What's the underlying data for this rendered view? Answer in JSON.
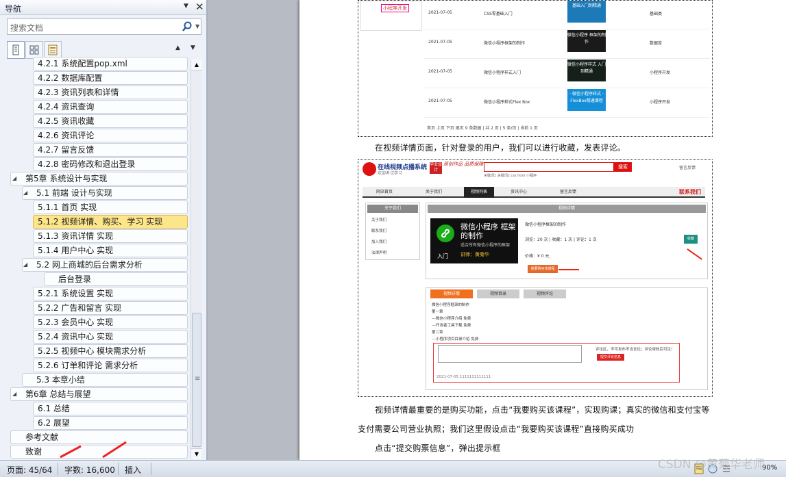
{
  "nav": {
    "title": "导航",
    "search_placeholder": "搜索文档",
    "items": [
      {
        "label": "4.2.1 系统配置pop.xml"
      },
      {
        "label": "4.2.2 数据库配置"
      },
      {
        "label": "4.2.3 资讯列表和详情"
      },
      {
        "label": "4.2.4 资讯查询"
      },
      {
        "label": "4.2.5 资讯收藏"
      },
      {
        "label": "4.2.6 资讯评论"
      },
      {
        "label": "4.2.7 留言反馈"
      },
      {
        "label": "4.2.8 密码修改和退出登录"
      },
      {
        "label": "第5章 系统设计与实现"
      },
      {
        "label": "5.1 前端 设计与实现"
      },
      {
        "label": "5.1.1 首页 实现"
      },
      {
        "label": "5.1.2 视频详情、购买、学习 实现"
      },
      {
        "label": "5.1.3 资讯详情 实现"
      },
      {
        "label": "5.1.4 用户中心 实现"
      },
      {
        "label": "5.2 网上商城的后台需求分析"
      },
      {
        "label": "后台登录"
      },
      {
        "label": "5.2.1 系统设置 实现"
      },
      {
        "label": "5.2.2 广告和留言 实现"
      },
      {
        "label": "5.2.3 会员中心 实现"
      },
      {
        "label": "5.2.4 资讯中心 实现"
      },
      {
        "label": "5.2.5 视频中心 模块需求分析"
      },
      {
        "label": "5.2.6 订单和评论 需求分析"
      },
      {
        "label": "5.3 本章小结"
      },
      {
        "label": "第6章 总结与展望"
      },
      {
        "label": "6.1 总结"
      },
      {
        "label": "6.2 展望"
      },
      {
        "label": "参考文献"
      },
      {
        "label": "致谢"
      }
    ]
  },
  "shot1": {
    "side_btn": "小程序开发",
    "rows": [
      {
        "date": "2021-07-05",
        "title": "CSS零基础入门",
        "thumb": "基础入门到精通",
        "cat": "基础类"
      },
      {
        "date": "2021-07-05",
        "title": "微信小程序框架的制作",
        "thumb": "微信小程序 框架的制作",
        "cat": "数据库"
      },
      {
        "date": "2021-07-05",
        "title": "微信小程序样式入门",
        "thumb": "微信小程序样式 入门到精通",
        "cat": "小程序开发"
      },
      {
        "date": "2021-07-05",
        "title": "微信小程序样式Flex Box",
        "thumb": "· 微信小程序样式 · FlexBox精通课程",
        "cat": "小程序开发"
      }
    ],
    "pagination": "首页 上页 下页 尾页     9 条数据 | 共 2 页 | 5 条/页 | 当前 1 页"
  },
  "para1": "在视频详情页面，针对登录的用户，我们可以进行收藏，发表评论。",
  "shot2": {
    "brand": "在线视频点播系统",
    "brand_sub": "欢迎考试学习",
    "badge": "毕业设计",
    "slogan": "原创作品 品质保障",
    "search_btn": "搜索",
    "keywords": "关键词1    关键词2    css    html    小程序",
    "login": "留言反馈",
    "menu": [
      "网站首页",
      "关于我们",
      "视频列表",
      "资讯中心",
      "留言反馈"
    ],
    "contact": "联系我们",
    "left_head": "关于我们",
    "left_items": [
      "关于我们",
      "联系我们",
      "加入我们",
      "法律声明"
    ],
    "main_head": "视频详情",
    "cover_title": "微信小程序 框架的制作",
    "cover_sub": "适合所有微信小程序的框架",
    "cover_teacher": "讲师：黄菊华",
    "cover_in": "入门",
    "course_title": "微信小程序框架的制作",
    "stats": "浏览：20 次  |  收藏：1 次  |  评论：1 次",
    "collect": "收藏",
    "price": "价格：¥ 0 元",
    "buy": "我要购买该课程",
    "tabs": [
      "视频详情",
      "视频目录",
      "视频评论"
    ],
    "lessons": [
      "微信小程序框架的制作",
      "第一章",
      "---微信小程序介绍 免费",
      "---开发者工具下载 免费",
      "第二章",
      "---小程序项目目录介绍 免费"
    ],
    "comment_hint": "评论区，不可发布不当言论；评论审核后可见！",
    "comment_submit": "提交评论信息",
    "comment_date": "2021-07-05 1111111111111"
  },
  "para2": "视频详情最重要的是购买功能，点击“我要购买该课程”，实现购课；真实的微信和支付宝等",
  "para3": "支付需要公司营业执照；我们这里假设点击“我要购买该课程”直接购买成功",
  "para4": "点击“提交购票信息”，弹出提示框",
  "status": {
    "page": "页面: 45/64",
    "words": "字数: 16,600",
    "mode": "插入",
    "zoom": "90%"
  },
  "watermark": "CSDN @黄菊华老师"
}
